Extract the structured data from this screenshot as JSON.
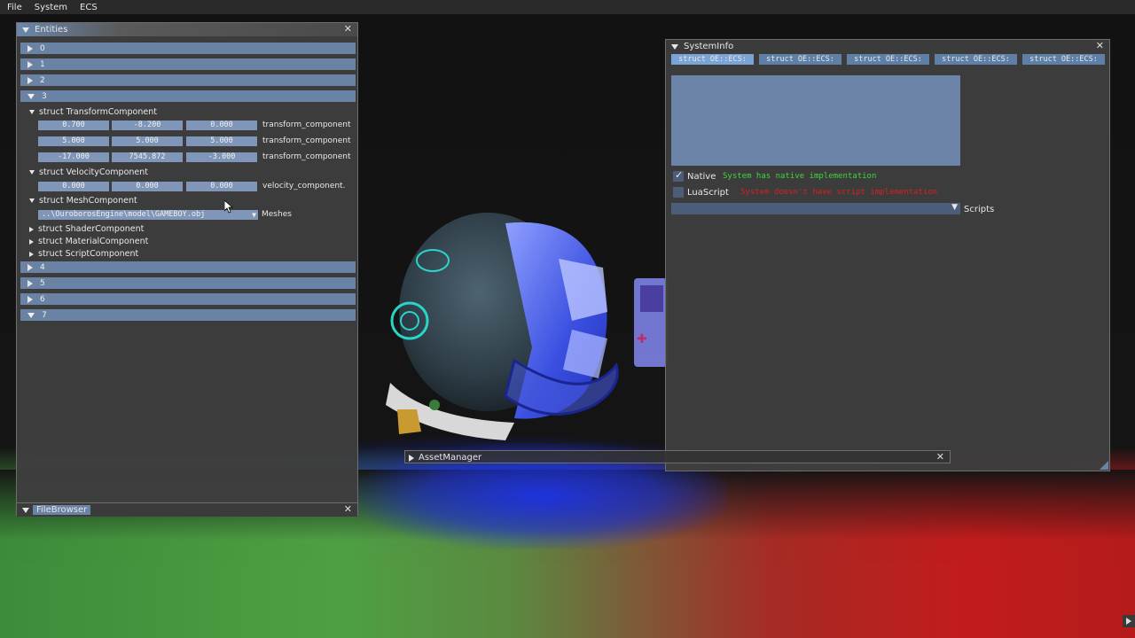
{
  "menu": [
    "File",
    "System",
    "ECS"
  ],
  "entities": {
    "title": "Entities",
    "rows": [
      {
        "label": "0",
        "open": false
      },
      {
        "label": "1",
        "open": false
      },
      {
        "label": "2",
        "open": false
      },
      {
        "label": "3",
        "open": true
      },
      {
        "label": "4",
        "open": false
      },
      {
        "label": "5",
        "open": false
      },
      {
        "label": "6",
        "open": false
      },
      {
        "label": "7",
        "open": true
      }
    ],
    "transform": {
      "header": "struct TransformComponent",
      "rows": [
        {
          "v": [
            "0.700",
            "-8.200",
            "0.000"
          ],
          "label": "transform_component"
        },
        {
          "v": [
            "5.000",
            "5.000",
            "5.000"
          ],
          "label": "transform_component"
        },
        {
          "v": [
            "-17.000",
            "7545.872",
            "-3.000"
          ],
          "label": "transform_component"
        }
      ]
    },
    "velocity": {
      "header": "struct VelocityComponent",
      "v": [
        "0.000",
        "0.000",
        "0.000"
      ],
      "label": "velocity_component."
    },
    "mesh": {
      "header": "struct MeshComponent",
      "path": "..\\OuroborosEngine\\model\\GAMEBOY.obj",
      "label": "Meshes"
    },
    "shader": "struct ShaderComponent",
    "material": "struct MaterialComponent",
    "script": "struct ScriptComponent"
  },
  "filebrowser": {
    "title": "FileBrowser"
  },
  "systeminfo": {
    "title": "SystemInfo",
    "tabs": [
      "struct OE::ECS:",
      "struct OE::ECS:",
      "struct OE::ECS:",
      "struct OE::ECS:",
      "struct OE::ECS:"
    ],
    "native_label": "Native",
    "native_msg": "System has native implementation",
    "lua_label": "LuaScript",
    "lua_msg": "System doesn't have script implementation",
    "scripts_label": "Scripts"
  },
  "assetmanager": {
    "title": "AssetManager"
  },
  "colors": {
    "accent": "#6a82a3",
    "native_msg": "#3ed63e",
    "lua_msg": "#d82020"
  }
}
